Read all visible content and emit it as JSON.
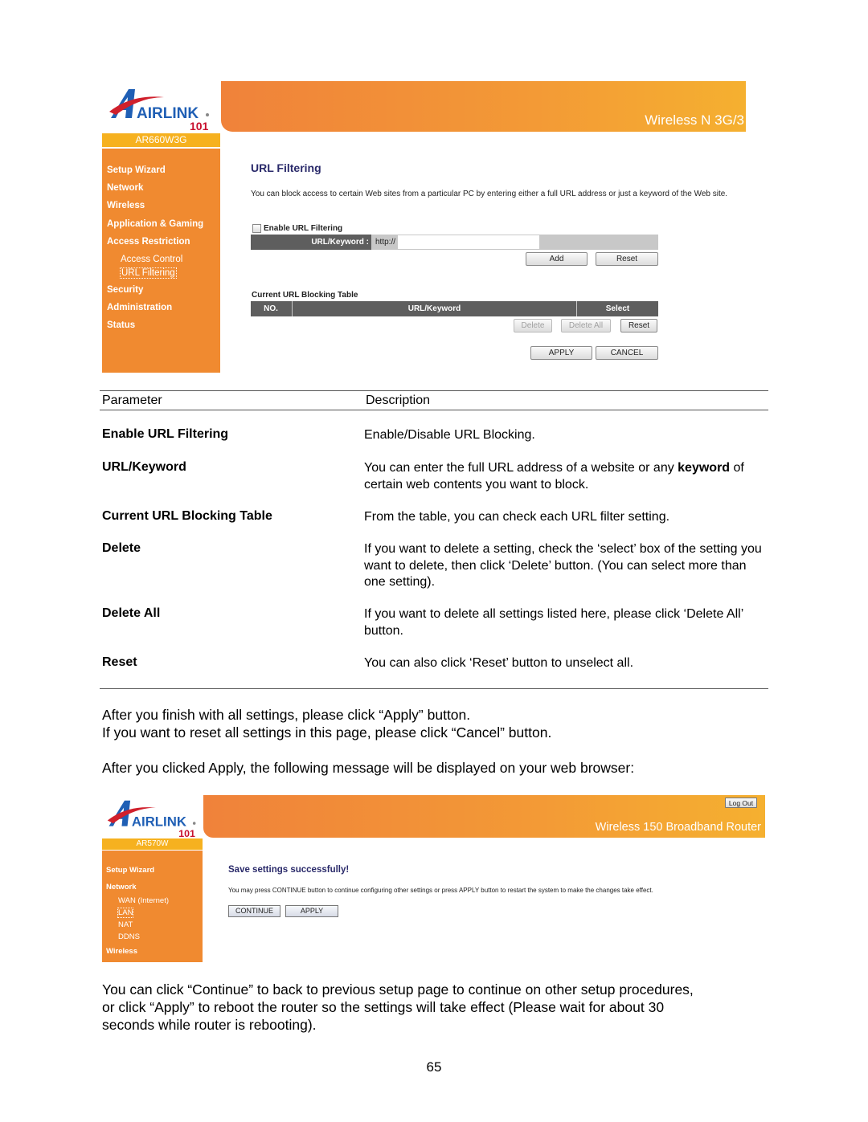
{
  "screenshot1": {
    "brand": {
      "logo_text": "AIRLINK",
      "logo_sub": "101",
      "model": "AR660W3G"
    },
    "banner_title": "Wireless N 3G/3",
    "sidebar": {
      "items": [
        {
          "label": "Setup Wizard"
        },
        {
          "label": "Network"
        },
        {
          "label": "Wireless"
        },
        {
          "label": "Application & Gaming"
        },
        {
          "label": "Access Restriction"
        },
        {
          "label": "Access Control",
          "sub": true
        },
        {
          "label": "URL Filtering",
          "sub": true,
          "active": true
        },
        {
          "label": "Security"
        },
        {
          "label": "Administration"
        },
        {
          "label": "Status"
        }
      ]
    },
    "main": {
      "title": "URL Filtering",
      "description": "You can block access to certain Web sites from a particular PC by entering either a full URL address or just a keyword of the Web site.",
      "enable_label": "Enable URL Filtering",
      "enable_checked": false,
      "url_label": "URL/Keyword :",
      "url_prefix": "http://",
      "url_value": "",
      "add_button": "Add",
      "reset_button": "Reset",
      "table_title": "Current URL Blocking Table",
      "table_columns": [
        "NO.",
        "URL/Keyword",
        "Select"
      ],
      "table_rows": [],
      "delete_button": "Delete",
      "delete_all_button": "Delete All",
      "table_reset_button": "Reset",
      "apply_button": "APPLY",
      "cancel_button": "CANCEL"
    }
  },
  "param_table": {
    "headers": [
      "Parameter",
      "Description"
    ],
    "rows": [
      {
        "name": "Enable URL Filtering",
        "desc": "Enable/Disable URL Blocking."
      },
      {
        "name": "URL/Keyword",
        "desc_pre": "You can enter the full URL address of a website or any ",
        "desc_bold": "keyword",
        "desc_post": " of certain web contents you want to block."
      },
      {
        "name": "Current URL Blocking Table",
        "desc": "From the table, you can check each URL filter setting."
      },
      {
        "name": "Delete",
        "desc": "If you want to delete a setting, check the ‘select’ box of the setting you want to delete, then click ‘Delete’ button. (You can select more than one setting)."
      },
      {
        "name": "Delete All",
        "desc": "If you want to delete all settings listed here, please click ‘Delete All’ button."
      },
      {
        "name": "Reset",
        "desc": "You can also click ‘Reset’ button to unselect all."
      }
    ]
  },
  "paragraphs": {
    "apply_note": "After you finish with all settings, please click “Apply” button.",
    "cancel_note": "If you want to reset all settings in this page, please click “Cancel” button.",
    "after_apply": "After you clicked Apply, the following message will be displayed on your web browser:",
    "continue_note_1": "You can click “Continue” to back to previous setup page to continue on other setup procedures,",
    "continue_note_2": "or click “Apply” to reboot the router so the settings will take effect (Please wait for about 30",
    "continue_note_3": "seconds while router is rebooting)."
  },
  "screenshot2": {
    "brand": {
      "logo_text": "AIRLINK",
      "logo_sub": "101",
      "model": "AR570W"
    },
    "banner_title": "Wireless 150 Broadband Router",
    "logout_button": "Log Out",
    "sidebar": {
      "items": [
        {
          "label": "Setup Wizard"
        },
        {
          "label": "Network"
        },
        {
          "label": "WAN (Internet)",
          "sub": true
        },
        {
          "label": "LAN",
          "sub": true,
          "active": true
        },
        {
          "label": "NAT",
          "sub": true
        },
        {
          "label": "DDNS",
          "sub": true
        },
        {
          "label": "Wireless"
        }
      ]
    },
    "main": {
      "title": "Save settings successfully!",
      "description": "You may press CONTINUE button to continue configuring other settings or press APPLY button to restart the system to make the changes take effect.",
      "continue_button": "CONTINUE",
      "apply_button": "APPLY"
    }
  },
  "page_number": "65",
  "colors": {
    "sidebar_orange": "#f08a30",
    "model_bar_yellow": "#f6b11f",
    "header_dark_gray": "#5e5e5e",
    "title_navy": "#2a2a6a"
  }
}
